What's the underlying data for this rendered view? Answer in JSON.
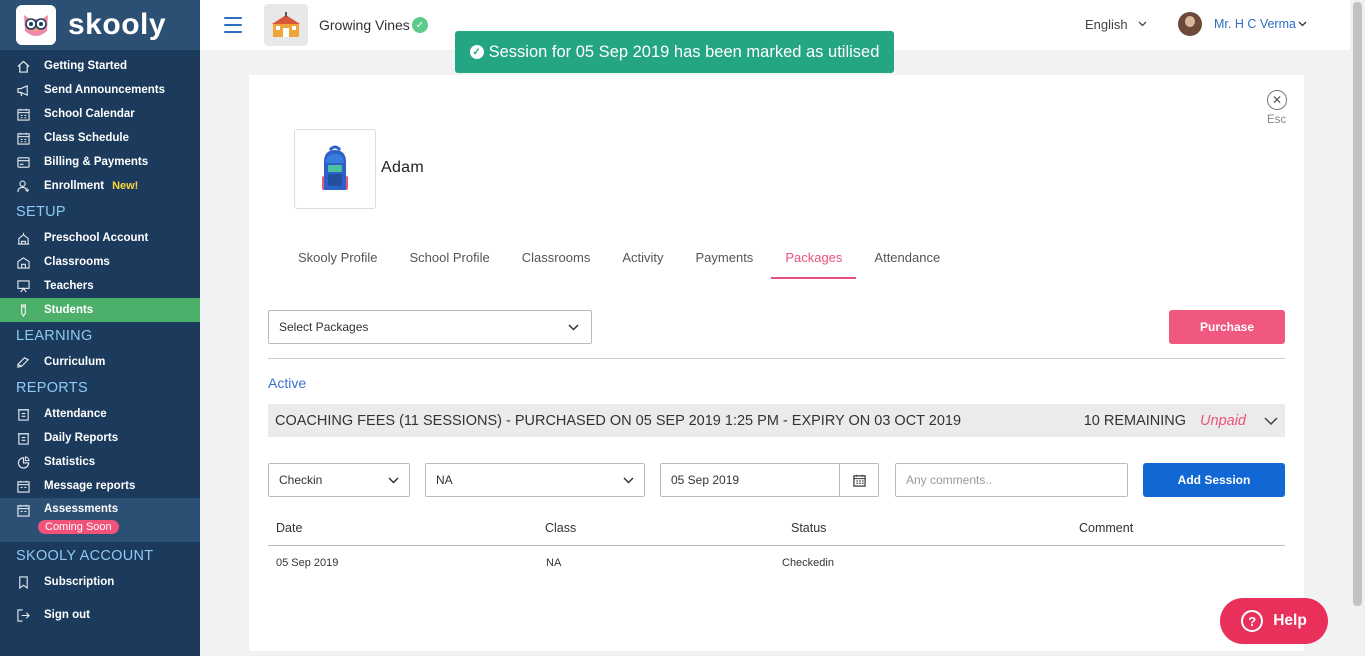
{
  "brand": {
    "logo_text": "skooly"
  },
  "sidebar": {
    "items_top": [
      {
        "label": "Getting Started",
        "icon": "home-icon"
      },
      {
        "label": "Send Announcements",
        "icon": "megaphone-icon"
      },
      {
        "label": "School Calendar",
        "icon": "calendar-icon"
      },
      {
        "label": "Class Schedule",
        "icon": "calendar-icon"
      },
      {
        "label": "Billing & Payments",
        "icon": "billing-icon"
      },
      {
        "label": "Enrollment",
        "icon": "user-add-icon",
        "badge": "New!"
      }
    ],
    "section_setup": "SETUP",
    "items_setup": [
      {
        "label": "Preschool Account",
        "icon": "school-icon"
      },
      {
        "label": "Classrooms",
        "icon": "building-icon"
      },
      {
        "label": "Teachers",
        "icon": "teacher-icon"
      },
      {
        "label": "Students",
        "icon": "pencil-icon"
      }
    ],
    "section_learning": "LEARNING",
    "items_learning": [
      {
        "label": "Curriculum",
        "icon": "book-icon"
      }
    ],
    "section_reports": "REPORTS",
    "items_reports": [
      {
        "label": "Attendance",
        "icon": "clipboard-icon"
      },
      {
        "label": "Daily Reports",
        "icon": "clipboard-icon"
      },
      {
        "label": "Statistics",
        "icon": "pie-chart-icon"
      },
      {
        "label": "Message reports",
        "icon": "calendar-icon"
      },
      {
        "label": "Assessments",
        "icon": "calendar-icon",
        "badge": "Coming Soon"
      }
    ],
    "section_account": "SKOOLY ACCOUNT",
    "items_account": [
      {
        "label": "Subscription",
        "icon": "bookmark-icon"
      },
      {
        "label": "Sign out",
        "icon": "sign-out-icon"
      }
    ]
  },
  "header": {
    "school_name": "Growing Vines",
    "language": "English",
    "user_name": "Mr. H C Verma"
  },
  "toast": {
    "message": "Session for 05 Sep 2019 has been marked as utilised"
  },
  "panel": {
    "close_label": "Esc",
    "student_name": "Adam",
    "tabs": [
      "Skooly Profile",
      "School Profile",
      "Classrooms",
      "Activity",
      "Payments",
      "Packages",
      "Attendance"
    ],
    "active_tab": "Packages",
    "select_packages": "Select Packages",
    "purchase_label": "Purchase",
    "active_label": "Active",
    "package": {
      "title": "COACHING FEES (11 SESSIONS) - PURCHASED ON 05 SEP 2019 1:25 PM - EXPIRY ON 03 OCT 2019",
      "remaining": "10 REMAINING",
      "status": "Unpaid"
    },
    "form": {
      "type_value": "Checkin",
      "class_value": "NA",
      "date_value": "05 Sep 2019",
      "comment_placeholder": "Any comments..",
      "add_session_label": "Add Session"
    },
    "table": {
      "headers": [
        "Date",
        "Class",
        "Status",
        "Comment"
      ],
      "rows": [
        {
          "date": "05 Sep 2019",
          "class": "NA",
          "status": "Checkedin",
          "comment": ""
        }
      ]
    }
  },
  "help": {
    "label": "Help"
  },
  "colors": {
    "sidebar_bg": "#1b3a5c",
    "active_green": "#4caf6a",
    "accent_pink": "#e8537d",
    "primary_blue": "#1167d3",
    "toast_green": "#24a584"
  }
}
